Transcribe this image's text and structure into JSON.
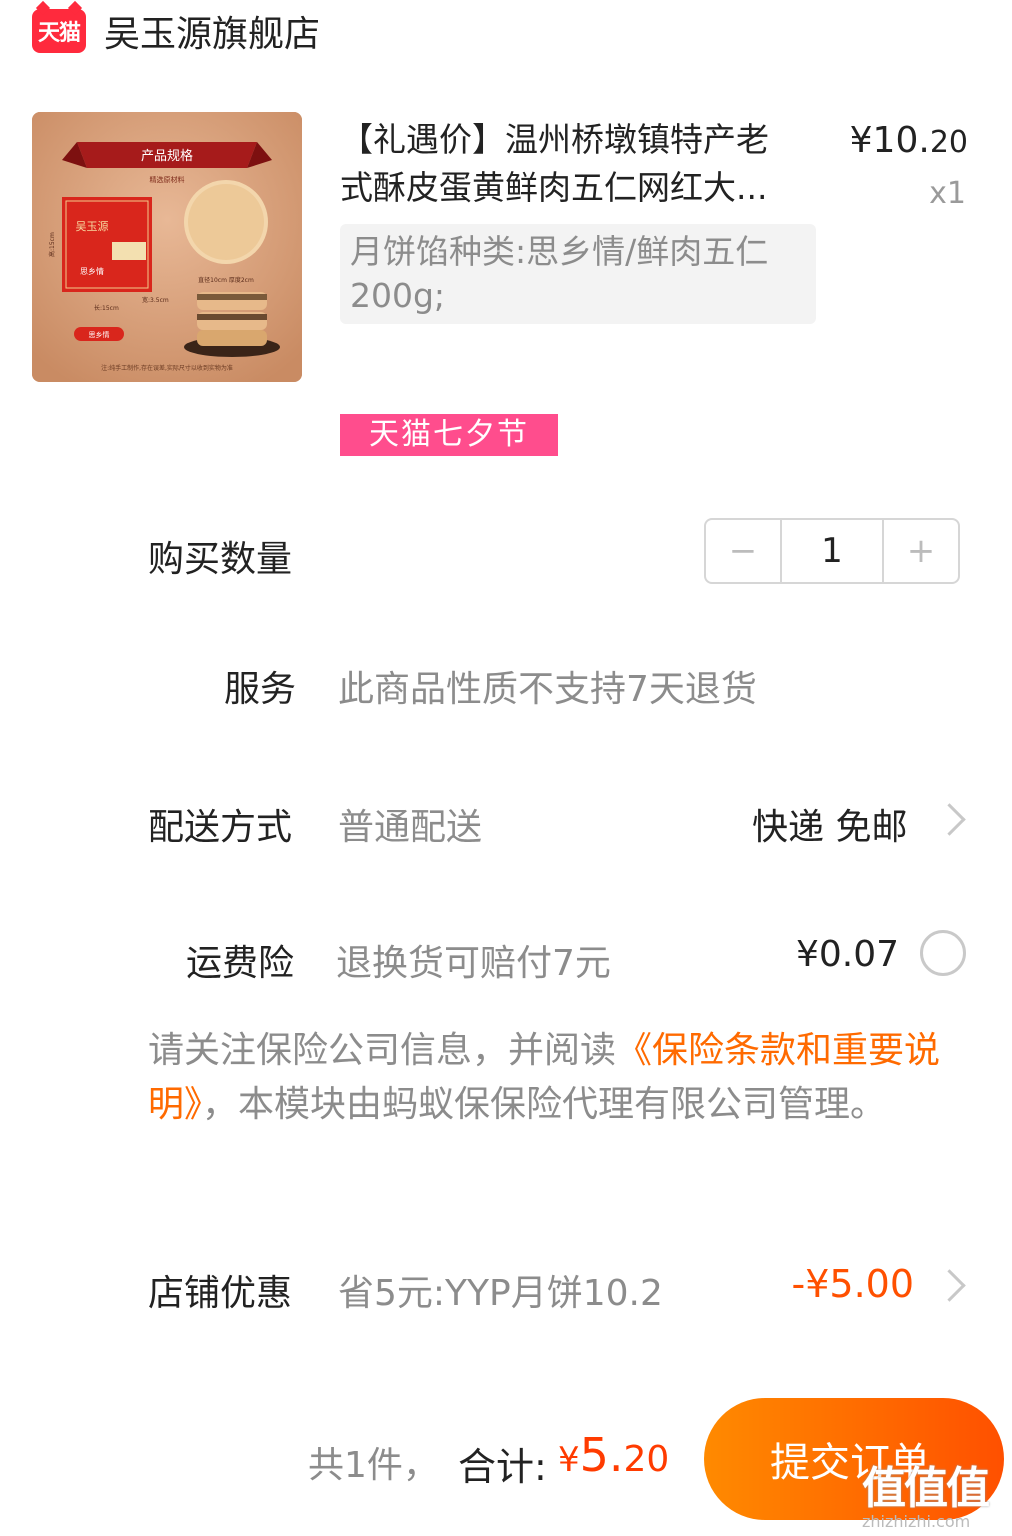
{
  "store": {
    "logo_text": "天猫",
    "name": "吴玉源旗舰店"
  },
  "product": {
    "title_line1": "【礼遇价】温州桥墩镇特产老",
    "title_line2": "式酥皮蛋黄鲜肉五仁网红大...",
    "price_int": "¥10.",
    "price_cents": "20",
    "qty": "x1",
    "sku_line1": "月饼馅种类:思乡情/鲜肉五仁",
    "sku_line2": "200g;",
    "promo_tag": "天猫七夕节",
    "image": {
      "banner": "产品规格",
      "banner_sub": "精选原材料",
      "box_title": "吴玉源",
      "box_label": "思乡情",
      "size_note": "直径10cm 厚度2cm",
      "dims_height": "高:15cm",
      "dims_width": "长:15cm",
      "dims_depth": "宽:3.5cm",
      "pill": "思乡情",
      "footnote": "注:纯手工制作,存在误差,实际尺寸以收到实物为准"
    }
  },
  "rows": {
    "quantity": {
      "label": "购买数量",
      "minus": "−",
      "value": "1",
      "plus": "+"
    },
    "service": {
      "label": "服务",
      "value": "此商品性质不支持7天退货"
    },
    "delivery": {
      "label": "配送方式",
      "value": "普通配送",
      "right": "快递 免邮"
    },
    "insurance": {
      "label": "运费险",
      "value": "退换货可赔付7元",
      "price": "¥0.07"
    },
    "notice": {
      "before": "请关注保险公司信息，并阅读",
      "link": "《保险条款和重要说明》",
      "after": "，本模块由蚂蚁保保险代理有限公司管理。"
    },
    "store_discount": {
      "label": "店铺优惠",
      "value": "省5元:YYP月饼10.2",
      "amount": "-¥5.00"
    }
  },
  "footer": {
    "count": "共1件，",
    "total_label": "合计:",
    "total_yen": "¥",
    "total_int": "5.",
    "total_dec": "20",
    "submit": "提交订单"
  },
  "watermark": {
    "mark": "值值值",
    "domain": "zhizhizhi.com"
  },
  "colors": {
    "accent": "#ff5000",
    "link": "#ff6a00",
    "tmall_red": "#ff2a3d",
    "promo_pink": "#ff4d8d"
  }
}
